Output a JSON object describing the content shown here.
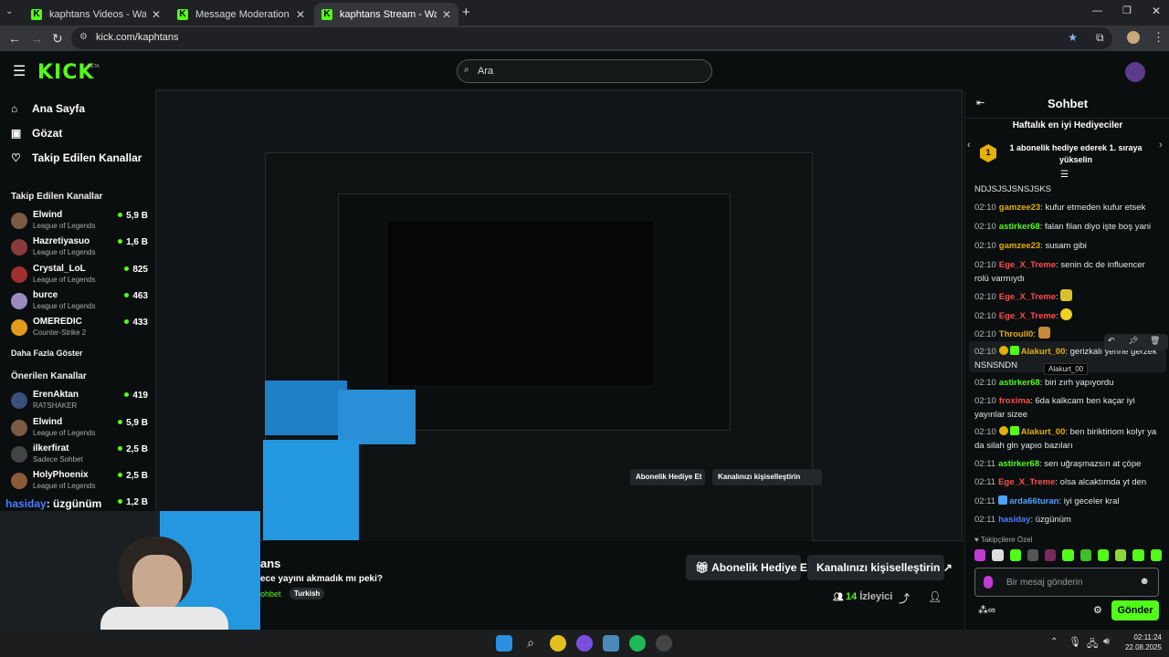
{
  "tabs": [
    {
      "title": "kaphtans Videos - Watch On-De"
    },
    {
      "title": "Message Moderation - Kick Da"
    },
    {
      "title": "kaphtans Stream - Watch Live o"
    }
  ],
  "address": {
    "url": "kick.com/kaphtans"
  },
  "site": {
    "logo": "KICK",
    "beta": "BETA",
    "search_placeholder": "Ara"
  },
  "sidebar": {
    "nav": [
      "Ana Sayfa",
      "Gözat",
      "Takip Edilen Kanallar"
    ],
    "followed_header": "Takip Edilen Kanallar",
    "followed": [
      {
        "name": "Elwind",
        "game": "League of Legends",
        "viewers": "5,9 B"
      },
      {
        "name": "Hazretiyasuo",
        "game": "League of Legends",
        "viewers": "1,6 B"
      },
      {
        "name": "Crystal_LoL",
        "game": "League of Legends",
        "viewers": "825"
      },
      {
        "name": "burce",
        "game": "League of Legends",
        "viewers": "463"
      },
      {
        "name": "OMEREDIC",
        "game": "Counter-Strike 2",
        "viewers": "433"
      }
    ],
    "show_more": "Daha Fazla Göster",
    "recommended_header": "Önerilen Kanallar",
    "recommended": [
      {
        "name": "ErenAktan",
        "game": "RATSHAKER",
        "viewers": "419"
      },
      {
        "name": "Elwind",
        "game": "League of Legends",
        "viewers": "5,9 B"
      },
      {
        "name": "ilkerfirat",
        "game": "Sadece Sohbet",
        "viewers": "2,5 B"
      },
      {
        "name": "HolyPhoenix",
        "game": "League of Legends",
        "viewers": "2,5 B"
      },
      {
        "name": "",
        "game": "",
        "viewers": "1,2 B"
      }
    ]
  },
  "overlay": {
    "user": "hasiday",
    "text": ": üzgünüm"
  },
  "stream": {
    "title_partial": "ans",
    "subtitle": "ece yayını akmadık mı peki?",
    "category": "ohbet",
    "tag": "Turkish",
    "viewers_count": "14",
    "viewers_label": "İzleyici",
    "gift_button": "Abonelik Hediye Et",
    "customize_button": "Kanalınızı kişiselleştirin"
  },
  "chat": {
    "title": "Sohbet",
    "gifters_title": "Haftalık en iyi Hediyeciler",
    "gifters_rank": "1",
    "gifters_text": "1 abonelik hediye ederek 1. sıraya yükselin",
    "first_line": "NDJSJSJSNSJSKS",
    "messages": [
      {
        "time": "02:10",
        "user": "gamzee23",
        "color": "#e3b008",
        "text": ": kufur etmeden kufur etsek"
      },
      {
        "time": "02:10",
        "user": "astirker68",
        "color": "#53fc18",
        "text": ": falan filan diyo işte boş yani"
      },
      {
        "time": "02:10",
        "user": "gamzee23",
        "color": "#e3b008",
        "text": ": susam gibi"
      },
      {
        "time": "02:10",
        "user": "Ege_X_Treme",
        "color": "#ff4d4d",
        "text": ": senin dc de influencer rolü varmıydı"
      },
      {
        "time": "02:10",
        "user": "Ege_X_Treme",
        "color": "#ff4d4d",
        "text": ":"
      },
      {
        "time": "02:10",
        "user": "Ege_X_Treme",
        "color": "#ff4d4d",
        "text": ":"
      },
      {
        "time": "02:10",
        "user": "Throull0",
        "color": "#e3b008",
        "text": ":"
      },
      {
        "time": "02:10",
        "user": "Alakurt_00",
        "color": "#e3b008",
        "text": ": gerizkalı yerine gerzek NSNSNDN"
      },
      {
        "time": "02:10",
        "user": "astirker68",
        "color": "#53fc18",
        "text": ": biri zırh yapıyordu"
      },
      {
        "time": "02:10",
        "user": "froxima",
        "color": "#ff4d4d",
        "text": ": 6da kalkcam ben kaçar iyi yayınlar sizee"
      },
      {
        "time": "02:10",
        "user": "Alakurt_00",
        "color": "#e3b008",
        "text": ": ben biriktiriom kolyr ya da silah gln yapıo bazıları"
      },
      {
        "time": "02:11",
        "user": "astirker68",
        "color": "#53fc18",
        "text": ": sen uğraşmazsın at çöpe"
      },
      {
        "time": "02:11",
        "user": "Ege_X_Treme",
        "color": "#ff4d4d",
        "text": ": olsa alcaktımda yt den"
      },
      {
        "time": "02:11",
        "user": "arda66turan",
        "color": "#4da3ff",
        "text": ": iyi geceler kral"
      },
      {
        "time": "02:11",
        "user": "hasiday",
        "color": "#4d7dff",
        "text": ": üzgünüm"
      }
    ],
    "tooltip": "Alakurt_00",
    "followers_only": "Takipçilere Özel",
    "input_placeholder": "Bir mesaj gönderin",
    "send_label": "Gönder"
  },
  "taskbar": {
    "time": "02:11:24",
    "date": "22.08.2025"
  },
  "colors": {
    "kick_green": "#53fc18"
  }
}
